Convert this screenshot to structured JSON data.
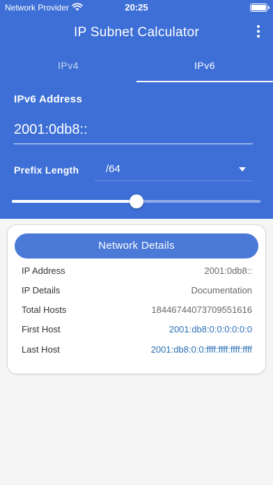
{
  "status_bar": {
    "carrier": "Network Provider",
    "time": "20:25"
  },
  "app_bar": {
    "title": "IP Subnet Calculator"
  },
  "tabs": [
    {
      "label": "IPv4",
      "selected": false
    },
    {
      "label": "IPv6",
      "selected": true
    }
  ],
  "form": {
    "address_label": "IPv6 Address",
    "address_value": "2001:0db8::",
    "prefix_label": "Prefix Length",
    "prefix_value": "/64",
    "prefix_slider_fraction": 0.5
  },
  "network_details": {
    "title": "Network Details",
    "rows": [
      {
        "label": "IP Address",
        "value": "2001:0db8::"
      },
      {
        "label": "IP Details",
        "value": "Documentation"
      },
      {
        "label": "Total Hosts",
        "value": "18446744073709551616"
      },
      {
        "label": "First Host",
        "value": "2001:db8:0:0:0:0:0:0"
      },
      {
        "label": "Last Host",
        "value": "2001:db8:0:0:ffff:ffff:ffff:ffff"
      }
    ]
  },
  "colors": {
    "primary": "#3d6fd6",
    "card_header": "#4a79d8",
    "link": "#2a6fb5",
    "background": "#f5f5f5"
  }
}
